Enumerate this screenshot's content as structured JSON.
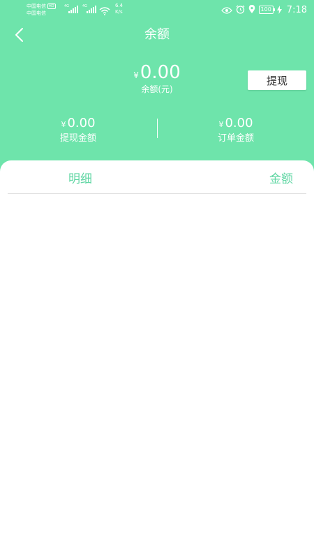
{
  "status_bar": {
    "carrier_1": "中国电信",
    "carrier_2": "中国电信",
    "hd_badge": "HD",
    "net_1": "4G",
    "net_2": "4G",
    "speed_value": "6.4",
    "speed_unit": "K/s",
    "battery": "100",
    "time": "7:18"
  },
  "header": {
    "title": "余额"
  },
  "balance": {
    "currency": "¥",
    "amount": "0.00",
    "label": "余额(元)",
    "withdraw_label": "提现"
  },
  "stats": [
    {
      "currency": "¥",
      "amount": "0.00",
      "label": "提现金额"
    },
    {
      "currency": "¥",
      "amount": "0.00",
      "label": "订单金额"
    }
  ],
  "list": {
    "col_detail": "明细",
    "col_amount": "金额"
  },
  "colors": {
    "header_bg": "#6ee4ab",
    "accent_text": "#5fd6a3"
  }
}
